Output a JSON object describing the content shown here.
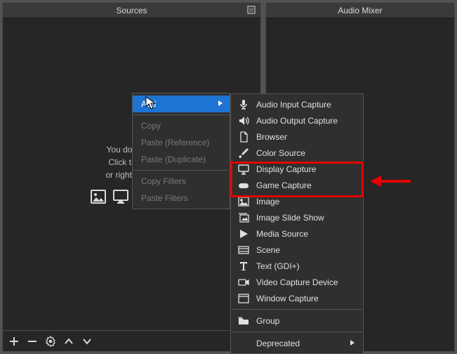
{
  "panels": {
    "sources": {
      "title": "Sources"
    },
    "audio_mixer": {
      "title": "Audio Mixer"
    }
  },
  "sources_hint": {
    "line1": "You don't hav",
    "line2": "Click the + b",
    "line3": "or right click h"
  },
  "context_menu": {
    "add": "Add",
    "copy": "Copy",
    "paste_ref": "Paste (Reference)",
    "paste_dup": "Paste (Duplicate)",
    "copy_filters": "Copy Filters",
    "paste_filters": "Paste Filters"
  },
  "submenu": {
    "audio_input": "Audio Input Capture",
    "audio_output": "Audio Output Capture",
    "browser": "Browser",
    "color_source": "Color Source",
    "display_capture": "Display Capture",
    "game_capture": "Game Capture",
    "image": "Image",
    "image_slideshow": "Image Slide Show",
    "media_source": "Media Source",
    "scene": "Scene",
    "text_gdi": "Text (GDI+)",
    "video_capture": "Video Capture Device",
    "window_capture": "Window Capture",
    "group": "Group",
    "deprecated": "Deprecated"
  },
  "colors": {
    "highlight_red": "#e60000",
    "selection_blue": "#1e74d2"
  }
}
